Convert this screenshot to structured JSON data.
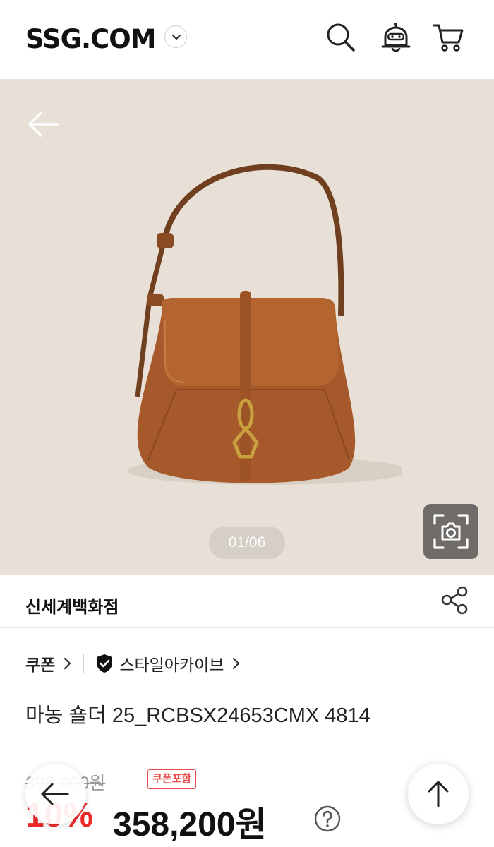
{
  "header": {
    "logo": "SSG.COM",
    "icons": [
      "chevron-down-icon",
      "search-icon",
      "chatbot-icon",
      "cart-icon"
    ]
  },
  "gallery": {
    "page_indicator": "01/06",
    "background": "#e8e0d7",
    "icons": [
      "back-arrow-icon",
      "image-search-icon"
    ]
  },
  "store": {
    "name": "신세계백화점",
    "share_icon": "share-icon"
  },
  "product": {
    "coupon_link": "쿠폰",
    "brand_link": "스타일아카이브",
    "name": "마농 숄더 25_RCBSX24653CMX 4814"
  },
  "price": {
    "original": "398,000원",
    "coupon_badge": "쿠폰포함",
    "discount": "10%",
    "sale": "358,200원",
    "discount_color": "#ee2a2a"
  }
}
